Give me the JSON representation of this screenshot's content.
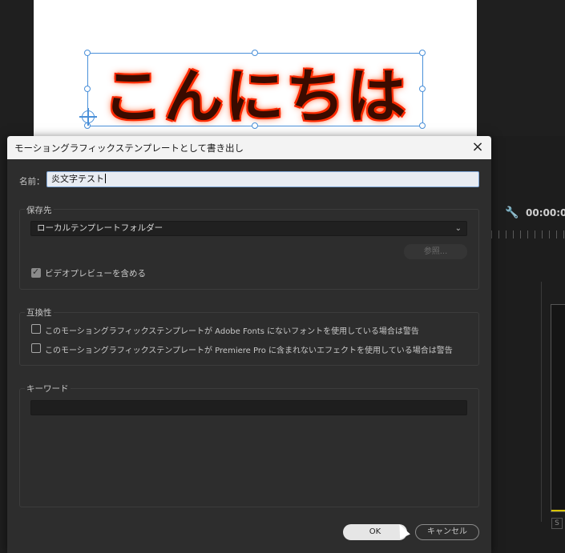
{
  "canvas": {
    "title_text": "こんにちは"
  },
  "background_panel": {
    "timecode": "00:00:0",
    "s_button": "S"
  },
  "dialog": {
    "title": "モーショングラフィックステンプレートとして書き出し",
    "close_icon": "×",
    "name": {
      "label": "名前：",
      "value": "炎文字テスト"
    },
    "destination": {
      "label": "保存先",
      "selected": "ローカルテンプレートフォルダー",
      "browse_label": "参照...",
      "include_preview_label": "ビデオプレビューを含める",
      "include_preview_checked": true
    },
    "compatibility": {
      "label": "互換性",
      "options": [
        {
          "label": "このモーショングラフィックステンプレートが Adobe Fonts にないフォントを使用している場合は警告",
          "checked": false
        },
        {
          "label": "このモーショングラフィックステンプレートが Premiere Pro に含まれないエフェクトを使用している場合は警告",
          "checked": false
        }
      ]
    },
    "keywords": {
      "label": "キーワード",
      "value": ""
    },
    "ok_label": "OK",
    "cancel_label": "キャンセル"
  },
  "colors": {
    "selection_blue": "#4a90d9",
    "dialog_bg": "#2d2d2d",
    "title_fire": "#ff3a00"
  },
  "icons": [
    "close-icon",
    "chevron-down-icon",
    "checkmark-icon",
    "wrench-icon",
    "anchor-point-icon",
    "mouse-cursor-icon"
  ]
}
